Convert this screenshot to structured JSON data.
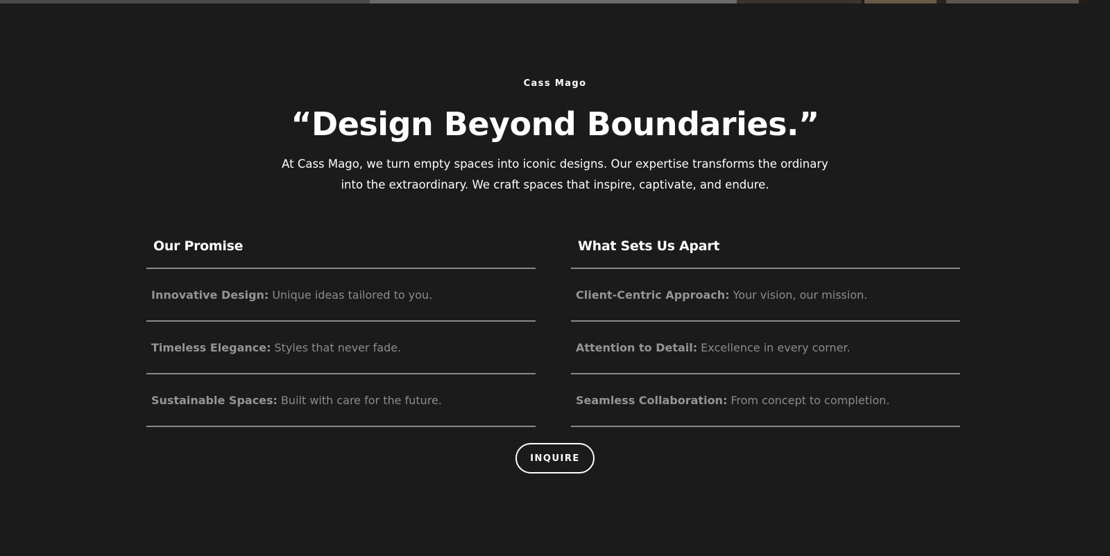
{
  "hero": {
    "eyebrow": "Cass Mago",
    "headline": "“Design Beyond Boundaries.”",
    "intro": "At Cass Mago, we turn empty spaces into iconic designs. Our expertise transforms the ordinary into the extraordinary. We craft spaces that inspire, captivate, and endure."
  },
  "promise": {
    "title": "Our Promise",
    "items": [
      {
        "term": "Innovative Design:",
        "desc": "Unique ideas tailored to you."
      },
      {
        "term": "Timeless Elegance:",
        "desc": "Styles that never fade."
      },
      {
        "term": "Sustainable Spaces:",
        "desc": "Built with care for the future."
      }
    ]
  },
  "apart": {
    "title": "What Sets Us Apart",
    "items": [
      {
        "term": "Client-Centric Approach:",
        "desc": "Your vision, our mission."
      },
      {
        "term": "Attention to Detail:",
        "desc": "Excellence in every corner."
      },
      {
        "term": "Seamless Collaboration:",
        "desc": "From concept to completion."
      }
    ]
  },
  "cta": {
    "label": "INQUIRE"
  },
  "colors": {
    "background": "#1b1b1b",
    "text": "#ffffff",
    "muted_text": "#8c8c8c",
    "divider": "#8a8a8a"
  }
}
